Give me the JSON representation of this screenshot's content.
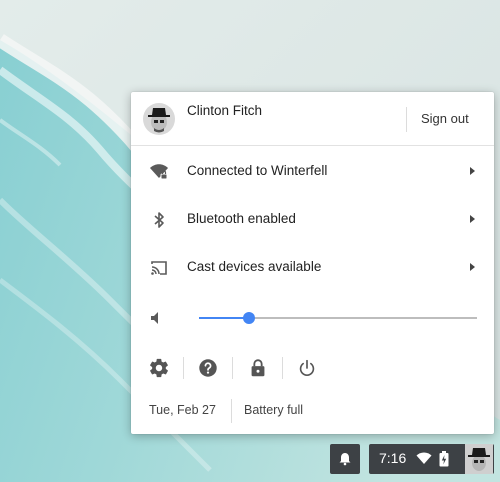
{
  "user": {
    "name": "Clinton Fitch",
    "sign_out_label": "Sign out"
  },
  "network": {
    "label": "Connected to Winterfell",
    "icon": "wifi-locked-icon"
  },
  "bluetooth": {
    "label": "Bluetooth enabled",
    "icon": "bluetooth-icon"
  },
  "cast": {
    "label": "Cast devices available",
    "icon": "cast-icon"
  },
  "volume": {
    "level": 0.18,
    "icon": "volume-icon"
  },
  "buttons": [
    "settings-icon",
    "help-icon",
    "lock-icon",
    "power-icon"
  ],
  "footer": {
    "date": "Tue, Feb 27",
    "battery": "Battery full"
  },
  "shelf": {
    "time": "7:16"
  },
  "colors": {
    "accent": "#4285f4",
    "shelf": "#3d4145"
  }
}
